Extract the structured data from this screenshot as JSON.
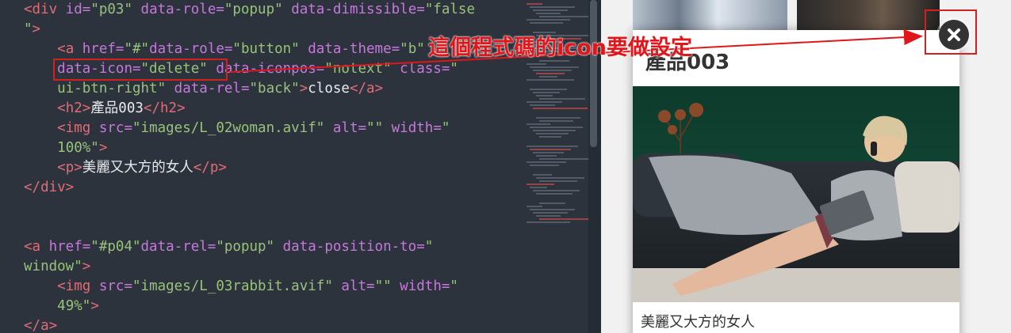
{
  "editor": {
    "lines": [
      [
        [
          "tg",
          "<"
        ],
        [
          "tg",
          "div "
        ],
        [
          "at",
          "id="
        ],
        [
          "st",
          "\"p03\" "
        ],
        [
          "at",
          "data-role="
        ],
        [
          "st",
          "\"popup\" "
        ],
        [
          "at",
          "data-dimissible="
        ],
        [
          "st",
          "\"false"
        ]
      ],
      [
        [
          "st",
          "\""
        ],
        [
          "tg",
          ">"
        ]
      ],
      [
        [
          "tx",
          "    "
        ],
        [
          "tg",
          "<a "
        ],
        [
          "at",
          "href="
        ],
        [
          "st",
          "\"#\""
        ],
        [
          "at",
          "data-role="
        ],
        [
          "st",
          "\"button\" "
        ],
        [
          "at",
          "data-theme="
        ],
        [
          "st",
          "\"b\""
        ]
      ],
      [
        [
          "tx",
          "    "
        ],
        [
          "at",
          "data-icon="
        ],
        [
          "st",
          "\"delete\" "
        ],
        [
          "at",
          "data-iconpos="
        ],
        [
          "st",
          "\"notext\" "
        ],
        [
          "at",
          "class="
        ],
        [
          "st",
          "\""
        ]
      ],
      [
        [
          "tx",
          "    "
        ],
        [
          "st",
          "ui-btn-right\" "
        ],
        [
          "at",
          "data-rel="
        ],
        [
          "st",
          "\"back\""
        ],
        [
          "tg",
          ">"
        ],
        [
          "tx",
          "close"
        ],
        [
          "tg",
          "</a>"
        ]
      ],
      [
        [
          "tx",
          "    "
        ],
        [
          "tg",
          "<h2>"
        ],
        [
          "tx",
          "產品003"
        ],
        [
          "tg",
          "</h2>"
        ]
      ],
      [
        [
          "tx",
          "    "
        ],
        [
          "tg",
          "<img "
        ],
        [
          "at",
          "src="
        ],
        [
          "st",
          "\"images/L_02woman.avif\" "
        ],
        [
          "at",
          "alt="
        ],
        [
          "st",
          "\"\" "
        ],
        [
          "at",
          "width="
        ],
        [
          "st",
          "\""
        ]
      ],
      [
        [
          "tx",
          "    "
        ],
        [
          "st",
          "100%\""
        ],
        [
          "tg",
          ">"
        ]
      ],
      [
        [
          "tx",
          "    "
        ],
        [
          "tg",
          "<p>"
        ],
        [
          "tx",
          "美麗又大方的女人"
        ],
        [
          "tg",
          "</p>"
        ]
      ],
      [
        [
          "tg",
          "</div>"
        ]
      ],
      [
        [
          "tx",
          ""
        ]
      ],
      [
        [
          "tx",
          ""
        ]
      ],
      [
        [
          "tg",
          "<a "
        ],
        [
          "at",
          "href="
        ],
        [
          "st",
          "\"#p04\""
        ],
        [
          "at",
          "data-rel="
        ],
        [
          "st",
          "\"popup\" "
        ],
        [
          "at",
          "data-position-to="
        ],
        [
          "st",
          "\""
        ]
      ],
      [
        [
          "st",
          "window\""
        ],
        [
          "tg",
          ">"
        ]
      ],
      [
        [
          "tx",
          "    "
        ],
        [
          "tg",
          "<img "
        ],
        [
          "at",
          "src="
        ],
        [
          "st",
          "\"images/L_03rabbit.avif\" "
        ],
        [
          "at",
          "alt="
        ],
        [
          "st",
          "\"\" "
        ],
        [
          "at",
          "width="
        ],
        [
          "st",
          "\""
        ]
      ],
      [
        [
          "tx",
          "    "
        ],
        [
          "st",
          "49%\""
        ],
        [
          "tg",
          ">"
        ]
      ],
      [
        [
          "tg",
          "</a>"
        ]
      ]
    ]
  },
  "preview": {
    "popup_title": "產品003",
    "popup_caption": "美麗又大方的女人",
    "close_icon": "delete-icon"
  },
  "annotation": {
    "text": "這個程式碼的icon要做設定",
    "color": "#e0161a"
  }
}
